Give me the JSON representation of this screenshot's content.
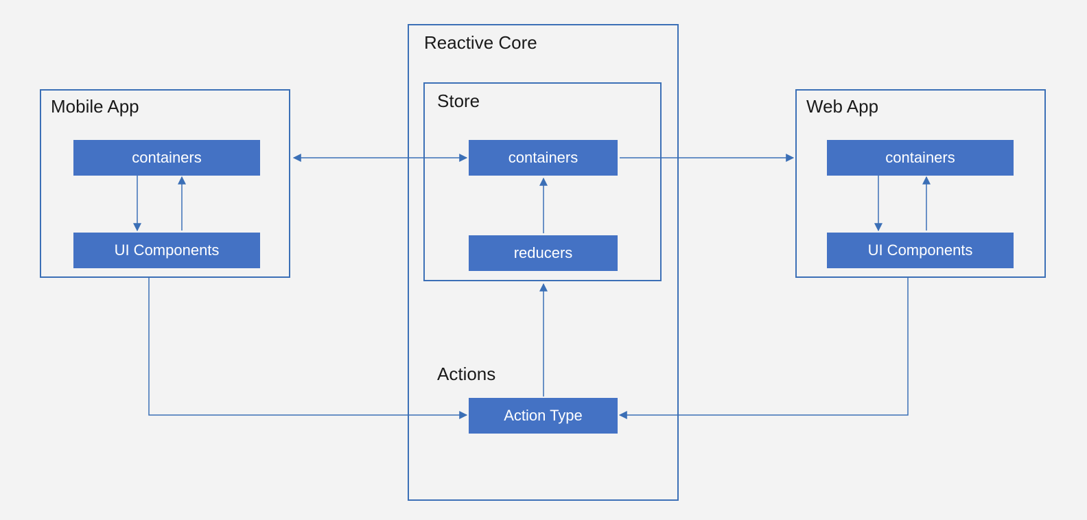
{
  "mobile": {
    "title": "Mobile App",
    "containers": "containers",
    "ui": "UI Components"
  },
  "core": {
    "title": "Reactive Core",
    "store_title": "Store",
    "store_containers": "containers",
    "store_reducers": "reducers",
    "actions_title": "Actions",
    "action_type": "Action Type"
  },
  "web": {
    "title": "Web App",
    "containers": "containers",
    "ui": "UI Components"
  },
  "colors": {
    "border": "#3b6fb6",
    "slab": "#4472c4",
    "bg": "#f3f3f3"
  }
}
